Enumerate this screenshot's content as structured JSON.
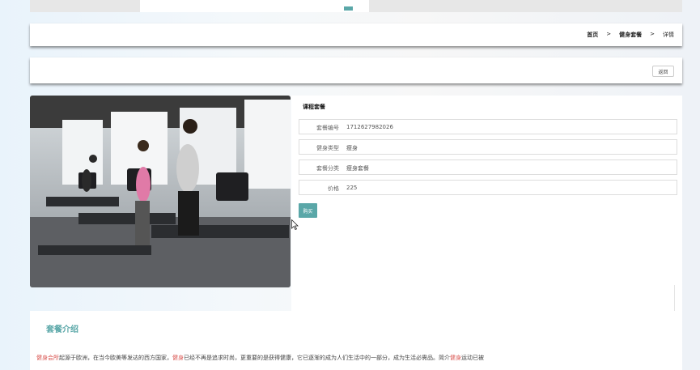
{
  "breadcrumb": {
    "home": "首页",
    "category": "健身套餐",
    "current": "详情",
    "separator": ">"
  },
  "actions": {
    "back_label": "返回"
  },
  "course": {
    "section_title": "课程套餐",
    "fields": [
      {
        "label": "套餐编号",
        "value": "1712627982026"
      },
      {
        "label": "健身类型",
        "value": "瘦身"
      },
      {
        "label": "套餐分类",
        "value": "瘦身套餐"
      },
      {
        "label": "价格",
        "value": "225"
      }
    ],
    "buy_label": "购买"
  },
  "intro": {
    "title": "套餐介绍",
    "text_parts": [
      {
        "t": "健身会所",
        "highlight": true
      },
      {
        "t": "起源于欧洲，在当今欧美等发达的西方国家，",
        "highlight": false
      },
      {
        "t": "健身",
        "highlight": true
      },
      {
        "t": "已经不再是追求时尚，更重要的是获得健康，它已逐渐的成为人们生活中的一部分，成为生活必需品。简介",
        "highlight": false
      },
      {
        "t": "健身",
        "highlight": true
      },
      {
        "t": "运动已被",
        "highlight": false
      }
    ]
  },
  "colors": {
    "accent": "#5aa7a8",
    "highlight": "#d9534f"
  }
}
